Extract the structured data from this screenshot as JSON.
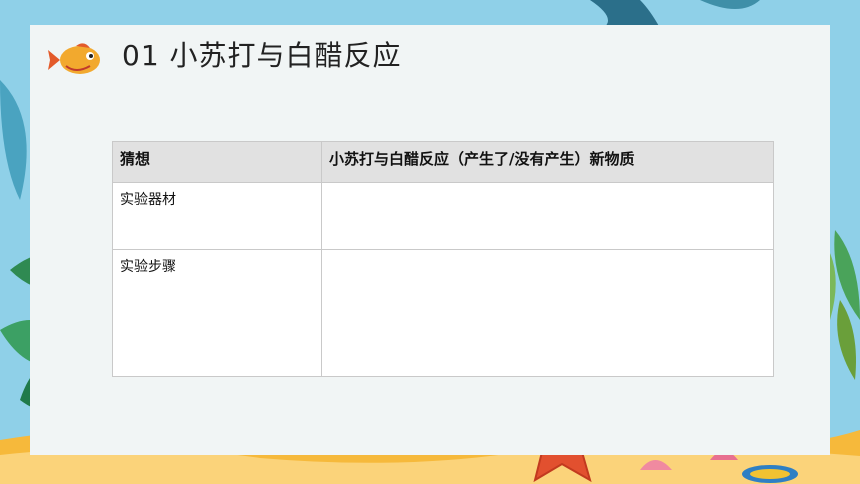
{
  "slide": {
    "title": "01 小苏打与白醋反应"
  },
  "table": {
    "headers": [
      "猜想",
      "小苏打与白醋反应（产生了/没有产生）新物质"
    ],
    "rows": [
      {
        "label": "实验器材",
        "value": ""
      },
      {
        "label": "实验步骤",
        "value": ""
      }
    ]
  },
  "icons": [
    "fish-icon",
    "starfish-icon",
    "seashell-icon",
    "flip-flop-icon",
    "leaf-icon"
  ],
  "colors": {
    "background": "#8fd0e8",
    "panel": "#f1f5f5",
    "sand": "#f6b93b",
    "starfish": "#e2502f"
  }
}
